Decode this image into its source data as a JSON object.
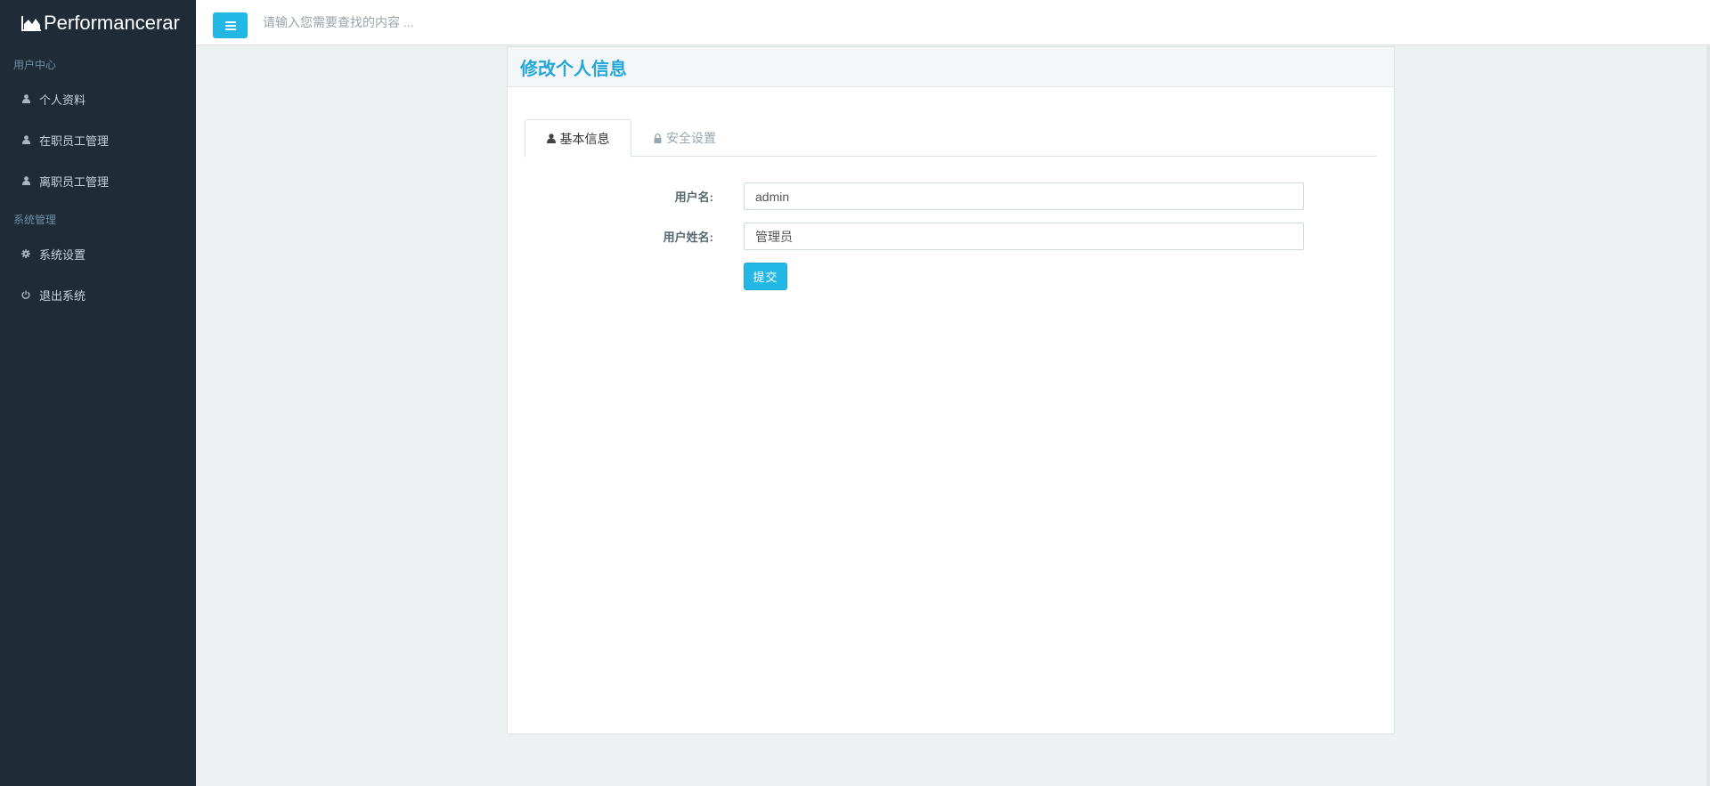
{
  "brand": {
    "name": "Performancerar",
    "icon": "area-chart-icon"
  },
  "sidebar": {
    "sections": [
      {
        "title": "用户中心",
        "items": [
          {
            "label": "个人资料",
            "icon": "user-icon"
          },
          {
            "label": "在职员工管理",
            "icon": "user-icon"
          },
          {
            "label": "离职员工管理",
            "icon": "user-icon"
          }
        ]
      },
      {
        "title": "系统管理",
        "items": [
          {
            "label": "系统设置",
            "icon": "gear-icon"
          },
          {
            "label": "退出系统",
            "icon": "power-icon"
          }
        ]
      }
    ]
  },
  "topbar": {
    "menu_icon": "hamburger-icon",
    "search_placeholder": "请输入您需要查找的内容 ..."
  },
  "panel": {
    "title": "修改个人信息",
    "tabs": [
      {
        "label": "基本信息",
        "icon": "user-icon",
        "active": true
      },
      {
        "label": "安全设置",
        "icon": "lock-icon",
        "active": false
      }
    ],
    "form": {
      "username_label": "用户名:",
      "username_value": "admin",
      "fullname_label": "用户姓名:",
      "fullname_value": "管理员",
      "submit_label": "提交"
    }
  },
  "colors": {
    "accent": "#23b7e5",
    "sidebar_bg": "#1f2c38",
    "title": "#23a7d8",
    "content_bg": "#eef1f2"
  }
}
